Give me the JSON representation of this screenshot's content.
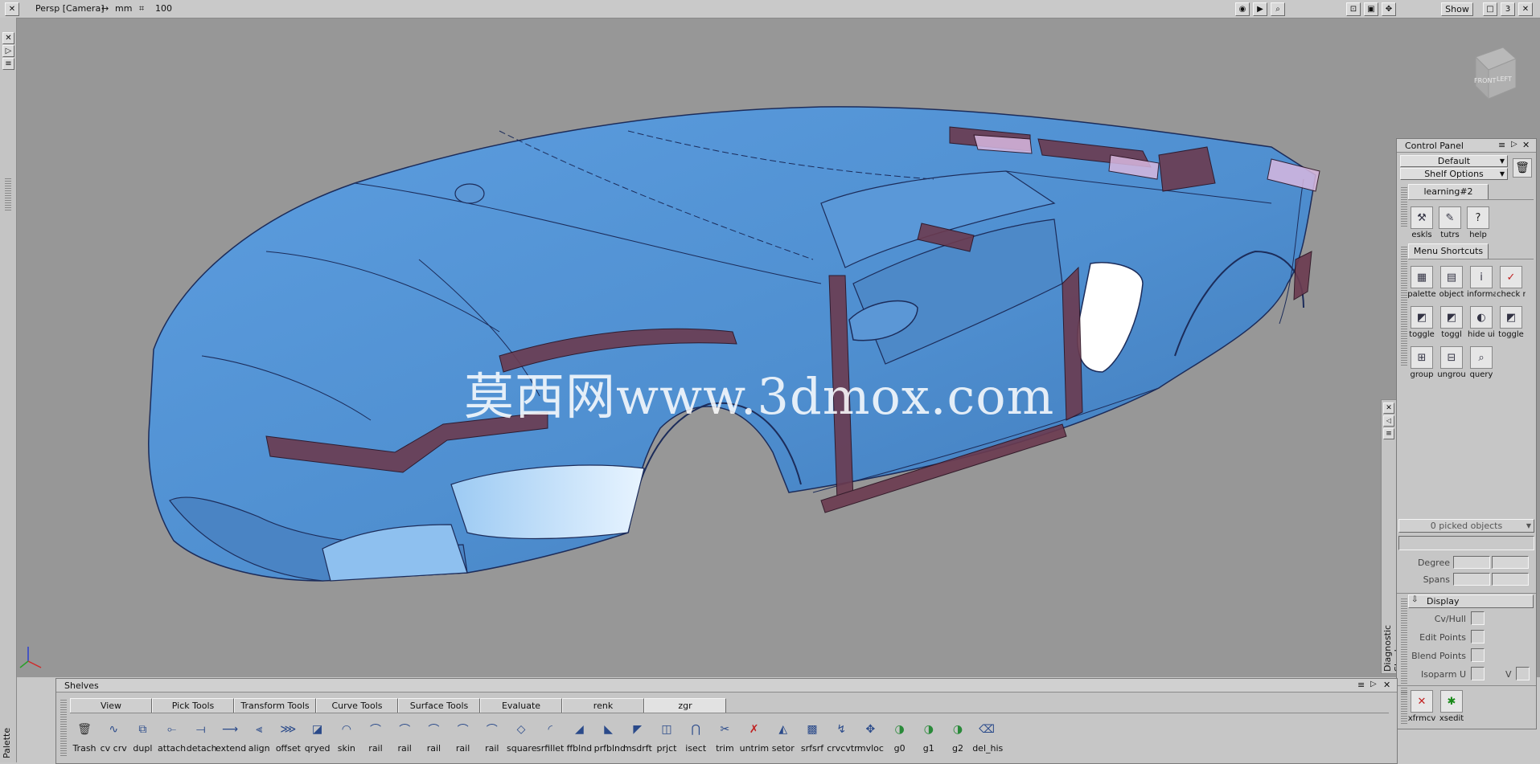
{
  "topbar": {
    "view_name": "Persp [Camera]",
    "units": "mm",
    "grid_value": "100",
    "show_label": "Show",
    "layout_number": "3"
  },
  "viewport": {
    "watermark": "莫西网www.3dmox.com",
    "view_cube": {
      "front": "FRONT",
      "left": "LEFT"
    }
  },
  "left_palette": {
    "label": "Palette"
  },
  "diagnostic": {
    "label": "Diagnostic Shade"
  },
  "control_panel": {
    "title": "Control Panel",
    "preset": "Default",
    "shelf_options": "Shelf Options",
    "tab_learning": "learning#2",
    "learning_items": [
      {
        "label": "eskls",
        "icon": "tools-icon"
      },
      {
        "label": "tutrs",
        "icon": "tutorial-icon"
      },
      {
        "label": "help",
        "icon": "help-icon"
      }
    ],
    "tab_menu": "Menu Shortcuts",
    "menu_items": [
      {
        "label": "palette",
        "icon": "palette-icon"
      },
      {
        "label": "object",
        "icon": "object-icon"
      },
      {
        "label": "informa",
        "icon": "info-icon"
      },
      {
        "label": "check r",
        "icon": "check-icon"
      },
      {
        "label": "toggle",
        "icon": "toggle-icon"
      },
      {
        "label": "toggl",
        "icon": "toggle-icon"
      },
      {
        "label": "hide ui",
        "icon": "hide-icon"
      },
      {
        "label": "toggle",
        "icon": "toggle-icon"
      },
      {
        "label": "group",
        "icon": "group-icon"
      },
      {
        "label": "ungrou",
        "icon": "ungroup-icon"
      },
      {
        "label": "query",
        "icon": "query-icon"
      }
    ],
    "picked": "0 picked objects",
    "degree_label": "Degree",
    "spans_label": "Spans",
    "display_section": "Display",
    "cv_hull": "Cv/Hull",
    "edit_points": "Edit Points",
    "blend_points": "Blend Points",
    "isoparm_u": "Isoparm U",
    "v_label": "V",
    "bottom_tools": [
      {
        "label": "xfrmcv",
        "icon": "transform-cv-icon"
      },
      {
        "label": "xsedit",
        "icon": "xsedit-icon"
      }
    ]
  },
  "shelves": {
    "title": "Shelves",
    "tabs": [
      "View",
      "Pick Tools",
      "Transform Tools",
      "Curve Tools",
      "Surface Tools",
      "Evaluate",
      "renk",
      "zgr"
    ],
    "active_tab": "zgr",
    "tools": [
      {
        "label": "Trash",
        "icon": "trash-icon"
      },
      {
        "label": "cv crv",
        "icon": "cv-curve-icon"
      },
      {
        "label": "dupl",
        "icon": "duplicate-icon"
      },
      {
        "label": "attach",
        "icon": "attach-icon"
      },
      {
        "label": "detach",
        "icon": "detach-icon"
      },
      {
        "label": "extend",
        "icon": "extend-icon"
      },
      {
        "label": "align",
        "icon": "align-icon"
      },
      {
        "label": "offset",
        "icon": "offset-icon"
      },
      {
        "label": "qryed",
        "icon": "query-edit-icon"
      },
      {
        "label": "skin",
        "icon": "skin-icon"
      },
      {
        "label": "rail",
        "icon": "rail-icon"
      },
      {
        "label": "rail",
        "icon": "rail-icon"
      },
      {
        "label": "rail",
        "icon": "rail-icon"
      },
      {
        "label": "rail",
        "icon": "rail-icon"
      },
      {
        "label": "rail",
        "icon": "rail-icon"
      },
      {
        "label": "square",
        "icon": "square-icon"
      },
      {
        "label": "srfillet",
        "icon": "fillet-icon"
      },
      {
        "label": "ffblnd",
        "icon": "blend-icon"
      },
      {
        "label": "prfblnd",
        "icon": "profile-blend-icon"
      },
      {
        "label": "msdrft",
        "icon": "draft-icon"
      },
      {
        "label": "prjct",
        "icon": "project-icon"
      },
      {
        "label": "isect",
        "icon": "intersect-icon"
      },
      {
        "label": "trim",
        "icon": "trim-icon"
      },
      {
        "label": "untrim",
        "icon": "untrim-icon"
      },
      {
        "label": "setor",
        "icon": "set-icon"
      },
      {
        "label": "srfsrf",
        "icon": "surface-icon"
      },
      {
        "label": "crvcvtr",
        "icon": "curve-convert-icon"
      },
      {
        "label": "mvloc",
        "icon": "move-locator-icon"
      },
      {
        "label": "g0",
        "icon": "continuity-icon"
      },
      {
        "label": "g1",
        "icon": "continuity-icon"
      },
      {
        "label": "g2",
        "icon": "continuity-icon"
      },
      {
        "label": "del_his",
        "icon": "delete-history-icon"
      }
    ]
  },
  "colors": {
    "viewport_bg": "#979797",
    "car_body": "#4f8fd0",
    "panel_bg": "#c6c6c6"
  }
}
